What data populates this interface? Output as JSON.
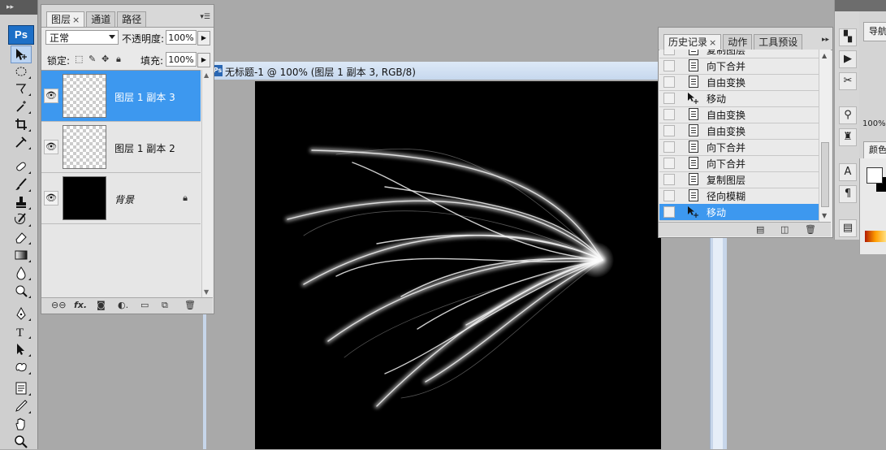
{
  "toolbar": {
    "logo": "Ps",
    "tools": [
      "move-tool",
      "marquee-tool",
      "lasso-tool",
      "magic-wand-tool",
      "crop-tool",
      "eyedropper-tool",
      "healing-brush-tool",
      "brush-tool",
      "clone-stamp-tool",
      "history-brush-tool",
      "eraser-tool",
      "gradient-tool",
      "blur-tool",
      "dodge-tool",
      "pen-tool",
      "type-tool",
      "path-selection-tool",
      "custom-shape-tool",
      "notes-tool",
      "eyedropper2-tool",
      "hand-tool",
      "zoom-tool"
    ]
  },
  "layers_panel": {
    "tabs": [
      {
        "label": "图层",
        "close": "×"
      },
      {
        "label": "通道"
      },
      {
        "label": "路径"
      }
    ],
    "blend_mode": "正常",
    "opacity_label": "不透明度:",
    "opacity_value": "100%",
    "lock_label": "锁定:",
    "fill_label": "填充:",
    "fill_value": "100%",
    "layers": [
      {
        "name": "图层 1 副本 3",
        "selected": true,
        "visible": true
      },
      {
        "name": "图层 1 副本 2",
        "selected": false,
        "visible": true
      },
      {
        "name": "背景",
        "selected": false,
        "visible": true,
        "locked": true
      }
    ],
    "footer_fx": "fx."
  },
  "document": {
    "title": "无标题-1 @ 100% (图层 1 副本 3, RGB/8)",
    "icon": "Ps"
  },
  "history_panel": {
    "tabs": [
      {
        "label": "历史记录",
        "close": "×"
      },
      {
        "label": "动作"
      },
      {
        "label": "工具预设"
      }
    ],
    "items": [
      {
        "label": "复制图层",
        "icon": "doc-icon"
      },
      {
        "label": "向下合并",
        "icon": "doc-icon"
      },
      {
        "label": "自由变换",
        "icon": "doc-icon"
      },
      {
        "label": "移动",
        "icon": "move-icon"
      },
      {
        "label": "自由变换",
        "icon": "doc-icon"
      },
      {
        "label": "自由变换",
        "icon": "doc-icon"
      },
      {
        "label": "向下合并",
        "icon": "doc-icon"
      },
      {
        "label": "向下合并",
        "icon": "doc-icon"
      },
      {
        "label": "复制图层",
        "icon": "doc-icon"
      },
      {
        "label": "径向模糊",
        "icon": "doc-icon"
      },
      {
        "label": "移动",
        "icon": "move-icon",
        "selected": true
      }
    ]
  },
  "right_dock": {
    "navigator_tab": "导航",
    "zoom": "100%",
    "color_tab": "颜色"
  },
  "colors": {
    "selection": "#3d98ef",
    "app_bg": "#a9a9a9",
    "canvas": "#000000",
    "logo_blue": "#1d6fc7"
  }
}
